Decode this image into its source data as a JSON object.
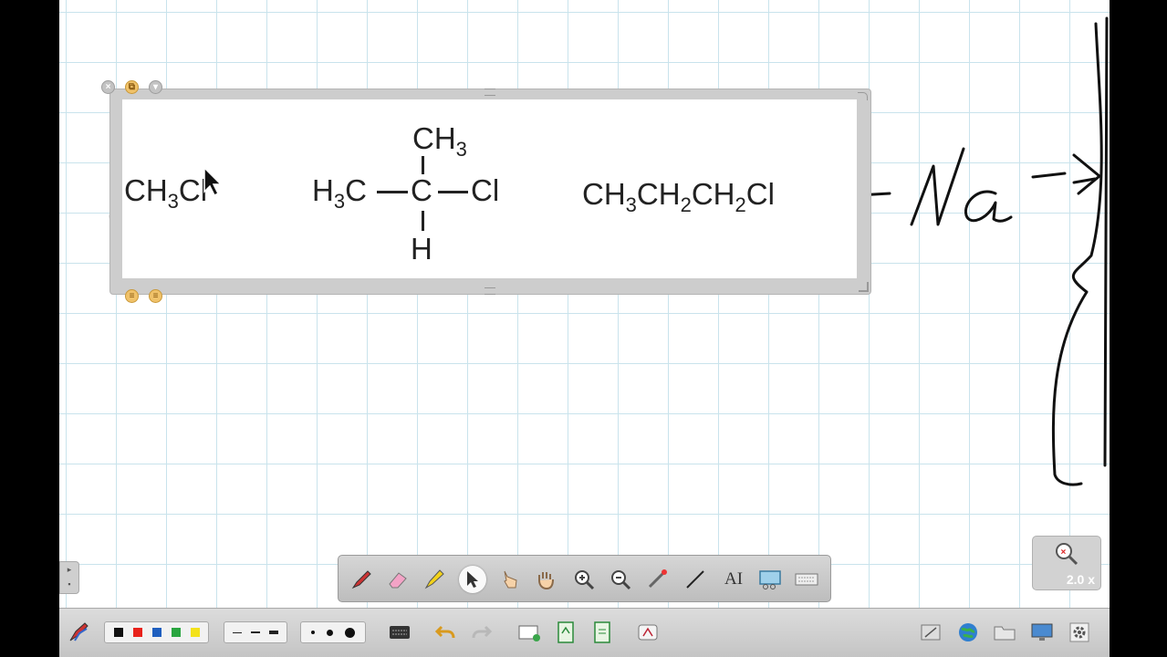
{
  "widget": {
    "formula_1": {
      "main": "CH",
      "sub": "3",
      "tail": "Cl"
    },
    "formula_2": {
      "top": "CH",
      "top_sub": "3",
      "left": "H",
      "left_sub": "3",
      "left_c": "C",
      "center": "C",
      "right": "Cl",
      "bottom": "H"
    },
    "formula_3": {
      "p1": "CH",
      "s1": "3",
      "p2": "CH",
      "s2": "2",
      "p3": "CH",
      "s3": "2",
      "p4": "Cl"
    }
  },
  "toolbar": {
    "tools": [
      "pen",
      "eraser",
      "highlighter",
      "select",
      "interact",
      "hand",
      "zoom-in",
      "zoom-out",
      "laser-pointer",
      "line",
      "text",
      "capture",
      "keyboard"
    ],
    "text_tool_label": "AI",
    "active_tool": "select"
  },
  "colors": {
    "black": "#111111",
    "red": "#e8221b",
    "blue": "#1f5fbf",
    "green": "#2aa540",
    "yellow": "#f3e21b"
  },
  "zoom": {
    "level": "2.0 x"
  }
}
